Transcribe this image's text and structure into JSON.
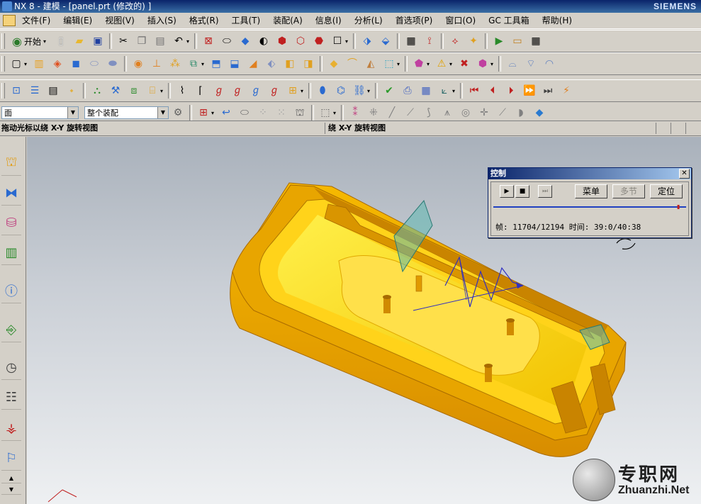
{
  "window": {
    "title": "NX 8 - 建模 - [panel.prt (修改的) ]",
    "brand": "SIEMENS"
  },
  "menu": {
    "items": [
      "文件(F)",
      "编辑(E)",
      "视图(V)",
      "插入(S)",
      "格式(R)",
      "工具(T)",
      "装配(A)",
      "信息(I)",
      "分析(L)",
      "首选项(P)",
      "窗口(O)",
      "GC 工具箱",
      "帮助(H)"
    ]
  },
  "toolbar": {
    "start_label": "开始"
  },
  "selection": {
    "filter_value": "面",
    "scope_value": "整个装配"
  },
  "cue": {
    "left": "拖动光标以绕 X-Y 旋转视图",
    "right": "绕 X-Y 旋转视图"
  },
  "dialog": {
    "title": "控制",
    "btn_menu": "菜单",
    "btn_multi": "多节",
    "btn_locate": "定位",
    "frame_label": "帧:",
    "frame_value": "11704/12194",
    "time_label": "时间:",
    "time_value": "39:0/40:38",
    "progress": 0.96
  },
  "watermark": {
    "cn": "专职网",
    "en": "Zhuanzhi.Net"
  },
  "colors": {
    "part_main": "#f5b800",
    "part_dark": "#d48a00",
    "part_light": "#ffd84a"
  }
}
